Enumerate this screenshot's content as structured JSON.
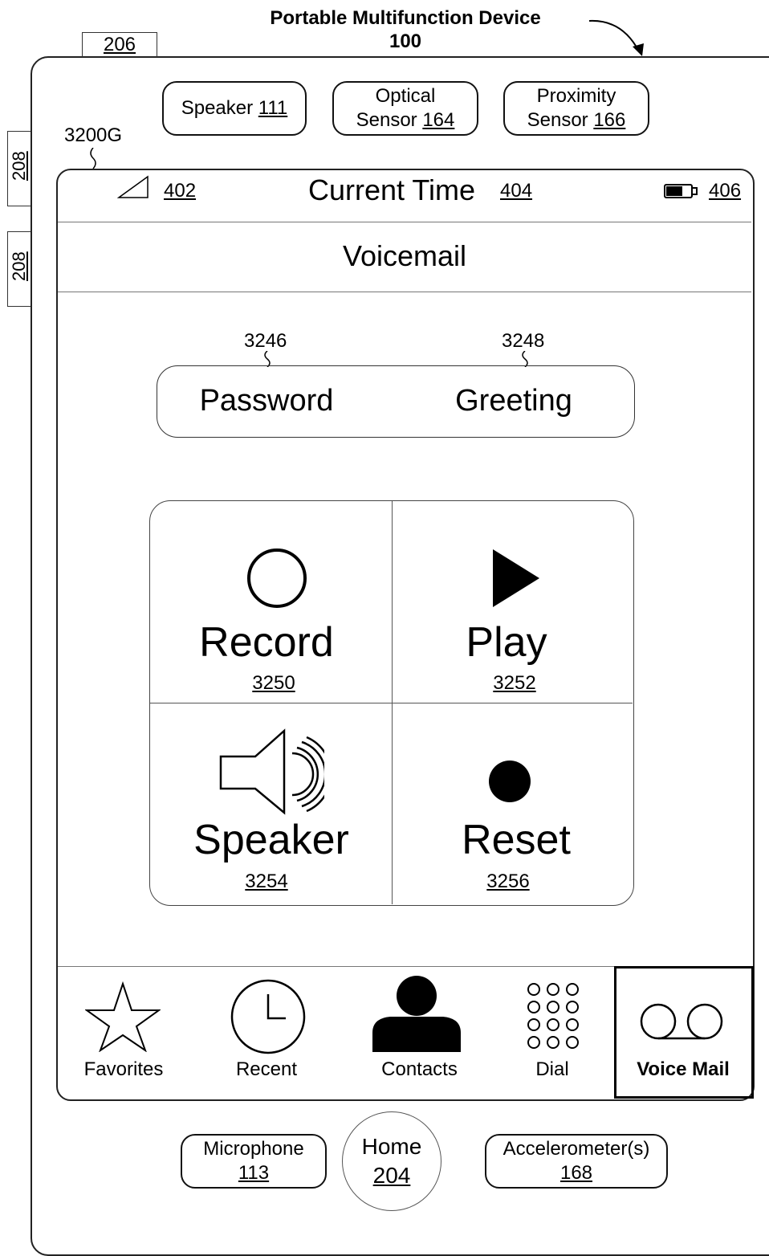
{
  "figure": {
    "title_line1": "Portable Multifunction Device",
    "title_line2": "100",
    "ref_206": "206",
    "ref_208_top": "208",
    "ref_208_bottom": "208",
    "screen_ref": "3200G"
  },
  "sensors": [
    {
      "label": "Speaker",
      "ref": "111"
    },
    {
      "label_line1": "Optical",
      "label_line2": "Sensor",
      "ref": "164"
    },
    {
      "label_line1": "Proximity",
      "label_line2": "Sensor",
      "ref": "166"
    }
  ],
  "status_bar": {
    "signal_ref": "402",
    "time_label": "Current Time",
    "time_ref": "404",
    "battery_ref": "406"
  },
  "nav": {
    "title": "Voicemail"
  },
  "settings": {
    "password_label": "Password",
    "password_ref": "3246",
    "greeting_label": "Greeting",
    "greeting_ref": "3248"
  },
  "controls": {
    "record": {
      "label": "Record",
      "ref": "3250",
      "icon": "circle-outline-icon"
    },
    "play": {
      "label": "Play",
      "ref": "3252",
      "icon": "play-triangle-icon"
    },
    "speaker": {
      "label": "Speaker",
      "ref": "3254",
      "icon": "speaker-icon"
    },
    "reset": {
      "label": "Reset",
      "ref": "3256",
      "icon": "filled-dot-icon"
    }
  },
  "tabs": [
    {
      "label": "Favorites",
      "icon": "star-icon"
    },
    {
      "label": "Recent",
      "icon": "clock-icon"
    },
    {
      "label": "Contacts",
      "icon": "person-icon"
    },
    {
      "label": "Dial",
      "icon": "keypad-icon"
    },
    {
      "label": "Voice Mail",
      "icon": "voicemail-icon",
      "selected": true
    }
  ],
  "hardware": {
    "microphone_label": "Microphone",
    "microphone_ref": "113",
    "home_label": "Home",
    "home_ref": "204",
    "accelerometer_label": "Accelerometer(s)",
    "accelerometer_ref": "168"
  }
}
